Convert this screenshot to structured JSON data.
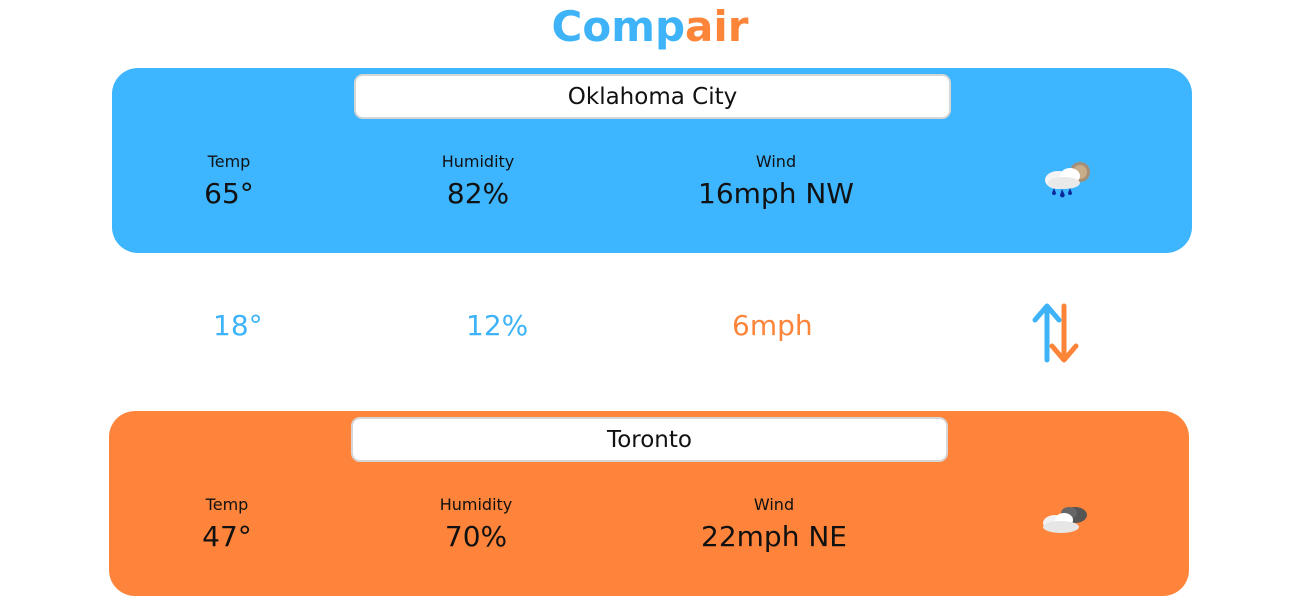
{
  "app": {
    "logo_part1": "Comp",
    "logo_part2": "air",
    "colors": {
      "blue": "#3db5ff",
      "orange": "#fd843a"
    }
  },
  "city1": {
    "name": "Oklahoma City",
    "temp_label": "Temp",
    "temp": "65°",
    "humidity_label": "Humidity",
    "humidity": "82%",
    "wind_label": "Wind",
    "wind": "16mph NW",
    "icon": "rain-cloud-sun-icon"
  },
  "comparison": {
    "temp_diff": "18°",
    "humidity_diff": "12%",
    "wind_diff": "6mph",
    "icon": "swap-arrows-icon"
  },
  "city2": {
    "name": "Toronto",
    "temp_label": "Temp",
    "temp": "47°",
    "humidity_label": "Humidity",
    "humidity": "70%",
    "wind_label": "Wind",
    "wind": "22mph NE",
    "icon": "cloudy-icon"
  }
}
